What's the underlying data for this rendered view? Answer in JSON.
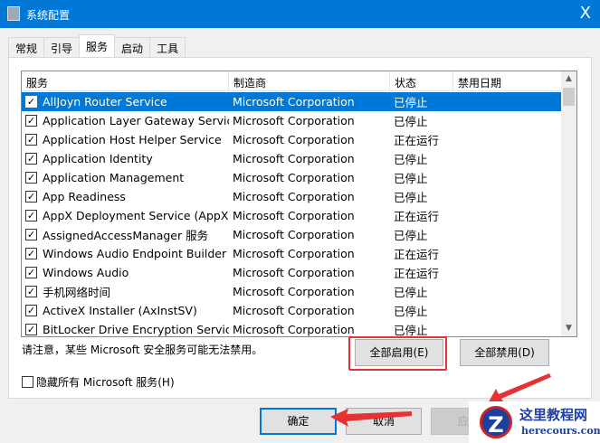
{
  "window": {
    "title": "系统配置",
    "close": "X"
  },
  "tabs": [
    "常规",
    "引导",
    "服务",
    "启动",
    "工具"
  ],
  "columns": [
    "服务",
    "制造商",
    "状态",
    "禁用日期"
  ],
  "rows": [
    {
      "service": "AllJoyn Router Service",
      "maker": "Microsoft Corporation",
      "status": "已停止",
      "date": "",
      "checked": true
    },
    {
      "service": "Application Layer Gateway Service",
      "maker": "Microsoft Corporation",
      "status": "已停止",
      "date": "",
      "checked": true
    },
    {
      "service": "Application Host Helper Service",
      "maker": "Microsoft Corporation",
      "status": "正在运行",
      "date": "",
      "checked": true
    },
    {
      "service": "Application Identity",
      "maker": "Microsoft Corporation",
      "status": "已停止",
      "date": "",
      "checked": true
    },
    {
      "service": "Application Management",
      "maker": "Microsoft Corporation",
      "status": "已停止",
      "date": "",
      "checked": true
    },
    {
      "service": "App Readiness",
      "maker": "Microsoft Corporation",
      "status": "已停止",
      "date": "",
      "checked": true
    },
    {
      "service": "AppX Deployment Service (AppX...",
      "maker": "Microsoft Corporation",
      "status": "正在运行",
      "date": "",
      "checked": true
    },
    {
      "service": "AssignedAccessManager 服务",
      "maker": "Microsoft Corporation",
      "status": "已停止",
      "date": "",
      "checked": true
    },
    {
      "service": "Windows Audio Endpoint Builder",
      "maker": "Microsoft Corporation",
      "status": "正在运行",
      "date": "",
      "checked": true
    },
    {
      "service": "Windows Audio",
      "maker": "Microsoft Corporation",
      "status": "正在运行",
      "date": "",
      "checked": true
    },
    {
      "service": "手机网络时间",
      "maker": "Microsoft Corporation",
      "status": "已停止",
      "date": "",
      "checked": true
    },
    {
      "service": "ActiveX Installer (AxInstSV)",
      "maker": "Microsoft Corporation",
      "status": "已停止",
      "date": "",
      "checked": true
    },
    {
      "service": "BitLocker Drive Encryption Service",
      "maker": "Microsoft Corporation",
      "status": "已停止",
      "date": "",
      "checked": true
    }
  ],
  "note": "请注意，某些 Microsoft 安全服务可能无法禁用。",
  "buttons": {
    "enable_all": "全部启用(E)",
    "disable_all": "全部禁用(D)",
    "ok": "确定",
    "cancel": "取消",
    "apply": "应用"
  },
  "hide_ms": {
    "label": "隐藏所有 Microsoft 服务(H)",
    "checked": false
  },
  "watermark": {
    "name": "这里教程网",
    "url": "herecours.com"
  }
}
